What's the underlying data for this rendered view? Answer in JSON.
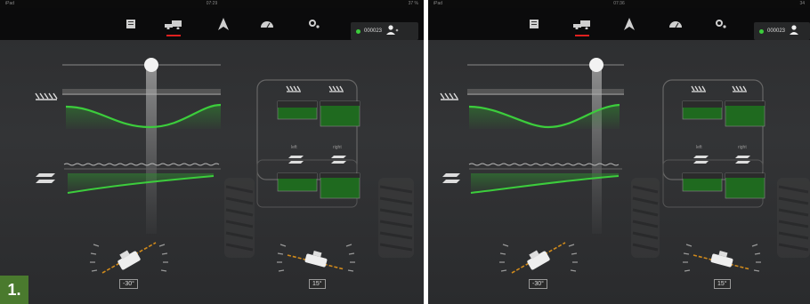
{
  "screens": [
    {
      "status": {
        "left": "iPad",
        "clock": "07:29",
        "battery": "37 %"
      },
      "machine_id": "000023",
      "label_left": "left",
      "label_right": "right",
      "angle_left": "-30°",
      "angle_right": "15°",
      "badge": "1."
    },
    {
      "status": {
        "left": "iPad",
        "clock": "07:36",
        "battery": "34"
      },
      "machine_id": "000023",
      "label_left": "left",
      "label_right": "right",
      "angle_left": "-30°",
      "angle_right": "15°"
    }
  ],
  "toolbar_icons": [
    "notes-icon",
    "machine-icon",
    "navigation-icon",
    "gauge-icon",
    "settings-icon"
  ],
  "colors": {
    "accent_green": "#3ccd3c",
    "active_red": "#e0201f",
    "badge_green": "#4a7a2e"
  }
}
